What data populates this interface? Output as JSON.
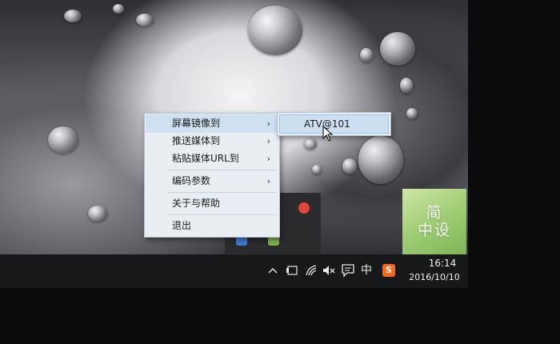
{
  "context_menu": {
    "items": [
      {
        "label": "屏幕镜像到",
        "has_submenu": true,
        "active": true
      },
      {
        "label": "推送媒体到",
        "has_submenu": true
      },
      {
        "label": "粘贴媒体URL到",
        "has_submenu": true
      },
      {
        "label": "编码参数",
        "has_submenu": true
      },
      {
        "label": "关于与帮助",
        "has_submenu": false
      },
      {
        "label": "退出",
        "has_submenu": false
      }
    ],
    "submenu_arrow": "›"
  },
  "submenu": {
    "items": [
      {
        "label": "ATV@101",
        "highlighted": true
      }
    ]
  },
  "tile": {
    "line1": "简",
    "line2": "中设"
  },
  "taskbar": {
    "icons": [
      "chevron-up-icon",
      "device-icon",
      "wifi-icon",
      "volume-muted-icon",
      "action-center-icon",
      "ime-icon",
      "sogou-icon"
    ],
    "ime_label": "中",
    "sogou_label": "S",
    "clock_time": "16:14",
    "clock_date": "2016/10/10"
  },
  "colors": {
    "menu_bg": "#e9eef3",
    "menu_highlight": "#cfe0f1",
    "taskbar_bg": "#17181a",
    "tile_green": "#9fcd73",
    "sogou_orange": "#f26a1b",
    "tray_red": "#e3443a"
  }
}
